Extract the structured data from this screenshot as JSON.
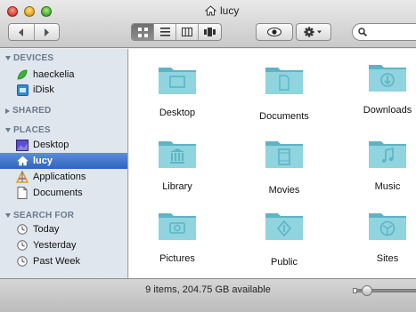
{
  "window": {
    "title": "lucy"
  },
  "toolbar": {
    "back_icon": "chevron-left",
    "forward_icon": "chevron-right",
    "view_modes": [
      "icon-view",
      "list-view",
      "column-view",
      "cover-flow-view"
    ],
    "active_view": "icon-view",
    "quicklook_icon": "eye",
    "action_icon": "gear",
    "search_icon": "magnifier",
    "search_value": ""
  },
  "sidebar": {
    "devices_header": "DEVICES",
    "devices": [
      {
        "label": "haeckelia",
        "icon": "green-leaf-icon"
      },
      {
        "label": "iDisk",
        "icon": "idisk-icon"
      }
    ],
    "shared_header": "SHARED",
    "places_header": "PLACES",
    "places": [
      {
        "label": "Desktop",
        "icon": "desktop-icon"
      },
      {
        "label": "lucy",
        "icon": "home-icon",
        "selected": true
      },
      {
        "label": "Applications",
        "icon": "applications-icon"
      },
      {
        "label": "Documents",
        "icon": "documents-icon"
      }
    ],
    "search_header": "SEARCH FOR",
    "searches": [
      {
        "label": "Today",
        "icon": "clock-icon"
      },
      {
        "label": "Yesterday",
        "icon": "clock-icon"
      },
      {
        "label": "Past Week",
        "icon": "clock-icon"
      }
    ]
  },
  "files": [
    {
      "label": "Desktop",
      "icon": "desktop-folder"
    },
    {
      "label": "Documents",
      "icon": "documents-folder"
    },
    {
      "label": "Downloads",
      "icon": "downloads-folder"
    },
    {
      "label": "Library",
      "icon": "library-folder"
    },
    {
      "label": "Movies",
      "icon": "movies-folder"
    },
    {
      "label": "Music",
      "icon": "music-folder"
    },
    {
      "label": "Pictures",
      "icon": "pictures-folder"
    },
    {
      "label": "Public",
      "icon": "public-folder"
    },
    {
      "label": "Sites",
      "icon": "sites-folder"
    }
  ],
  "status": {
    "text": "9 items, 204.75 GB available"
  },
  "colors": {
    "folder_fill": "#8fd4df",
    "folder_dark": "#5fb3c3",
    "sidebar_bg": "#dfe6ee",
    "selection": "#3a70c8"
  }
}
